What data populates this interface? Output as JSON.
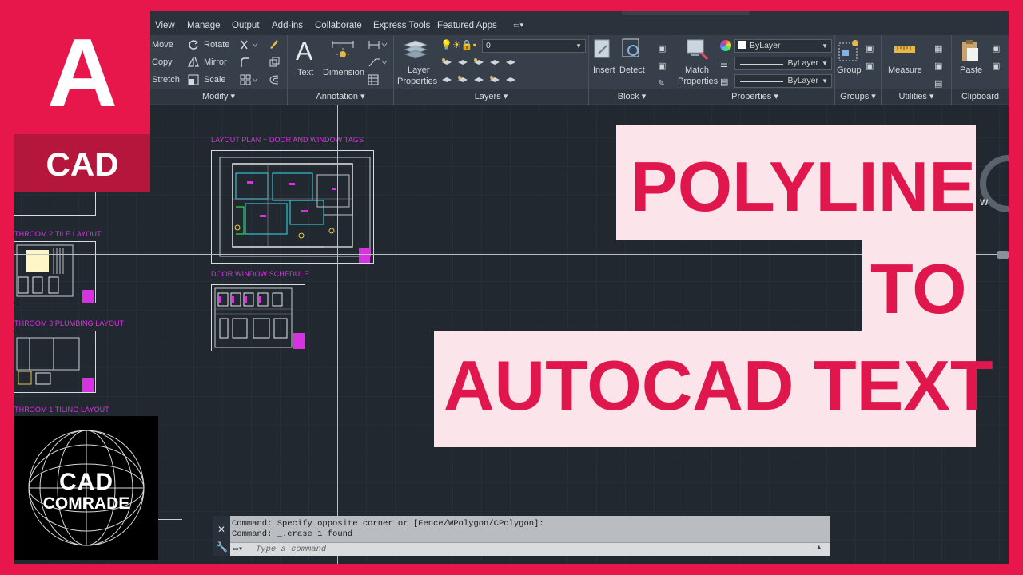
{
  "menu": {
    "tabs": [
      "View",
      "Manage",
      "Output",
      "Add-ins",
      "Collaborate",
      "Express Tools",
      "Featured Apps"
    ]
  },
  "ribbon": {
    "modify": {
      "title": "Modify",
      "items": [
        "Move",
        "Rotate",
        "Copy",
        "Mirror",
        "Stretch",
        "Scale"
      ]
    },
    "annotation": {
      "title": "Annotation",
      "text": "Text",
      "dimension": "Dimension"
    },
    "layers": {
      "title": "Layers",
      "layer_properties": "Layer\nProperties",
      "layer_properties_l1": "Layer",
      "layer_properties_l2": "Properties",
      "current_layer": "0"
    },
    "block": {
      "title": "Block",
      "insert": "Insert",
      "detect": "Detect"
    },
    "properties": {
      "title": "Properties",
      "match_l1": "Match",
      "match_l2": "Properties",
      "color": "ByLayer",
      "linetype": "ByLayer",
      "lineweight": "ByLayer"
    },
    "groups": {
      "title": "Groups",
      "group": "Group"
    },
    "utilities": {
      "title": "Utilities",
      "measure": "Measure"
    },
    "clipboard": {
      "title": "Clipboard",
      "paste": "Paste"
    }
  },
  "drawing": {
    "labels": {
      "layout_plan": "LAYOUT PLAN + DOOR AND WINDOW TAGS",
      "door_window": "DOOR WINDOW SCHEDULE",
      "bath2": "THROOM 2 TILE LAYOUT",
      "bath3": "THROOM 3 PLUMBING LAYOUT",
      "bath1": "THROOM 1 TILING LAYOUT"
    }
  },
  "command": {
    "line1": "Command: Specify opposite corner or [Fence/WPolygon/CPolygon]:",
    "line2": "Command: _.erase 1 found",
    "placeholder": "Type a command"
  },
  "overlay": {
    "logo_letter": "A",
    "logo_cad": "CAD",
    "comrade_1": "CAD",
    "comrade_2": "COMRADE",
    "title_1": "POLYLINE",
    "title_2": "TO",
    "title_3": "AUTOCAD TEXT",
    "compass_w": "W"
  },
  "colors": {
    "brand": "#e8174b",
    "title_bg": "#fbe4ea",
    "title_text": "#e0174d",
    "canvas": "#212830",
    "magenta_text": "#d633e0"
  }
}
